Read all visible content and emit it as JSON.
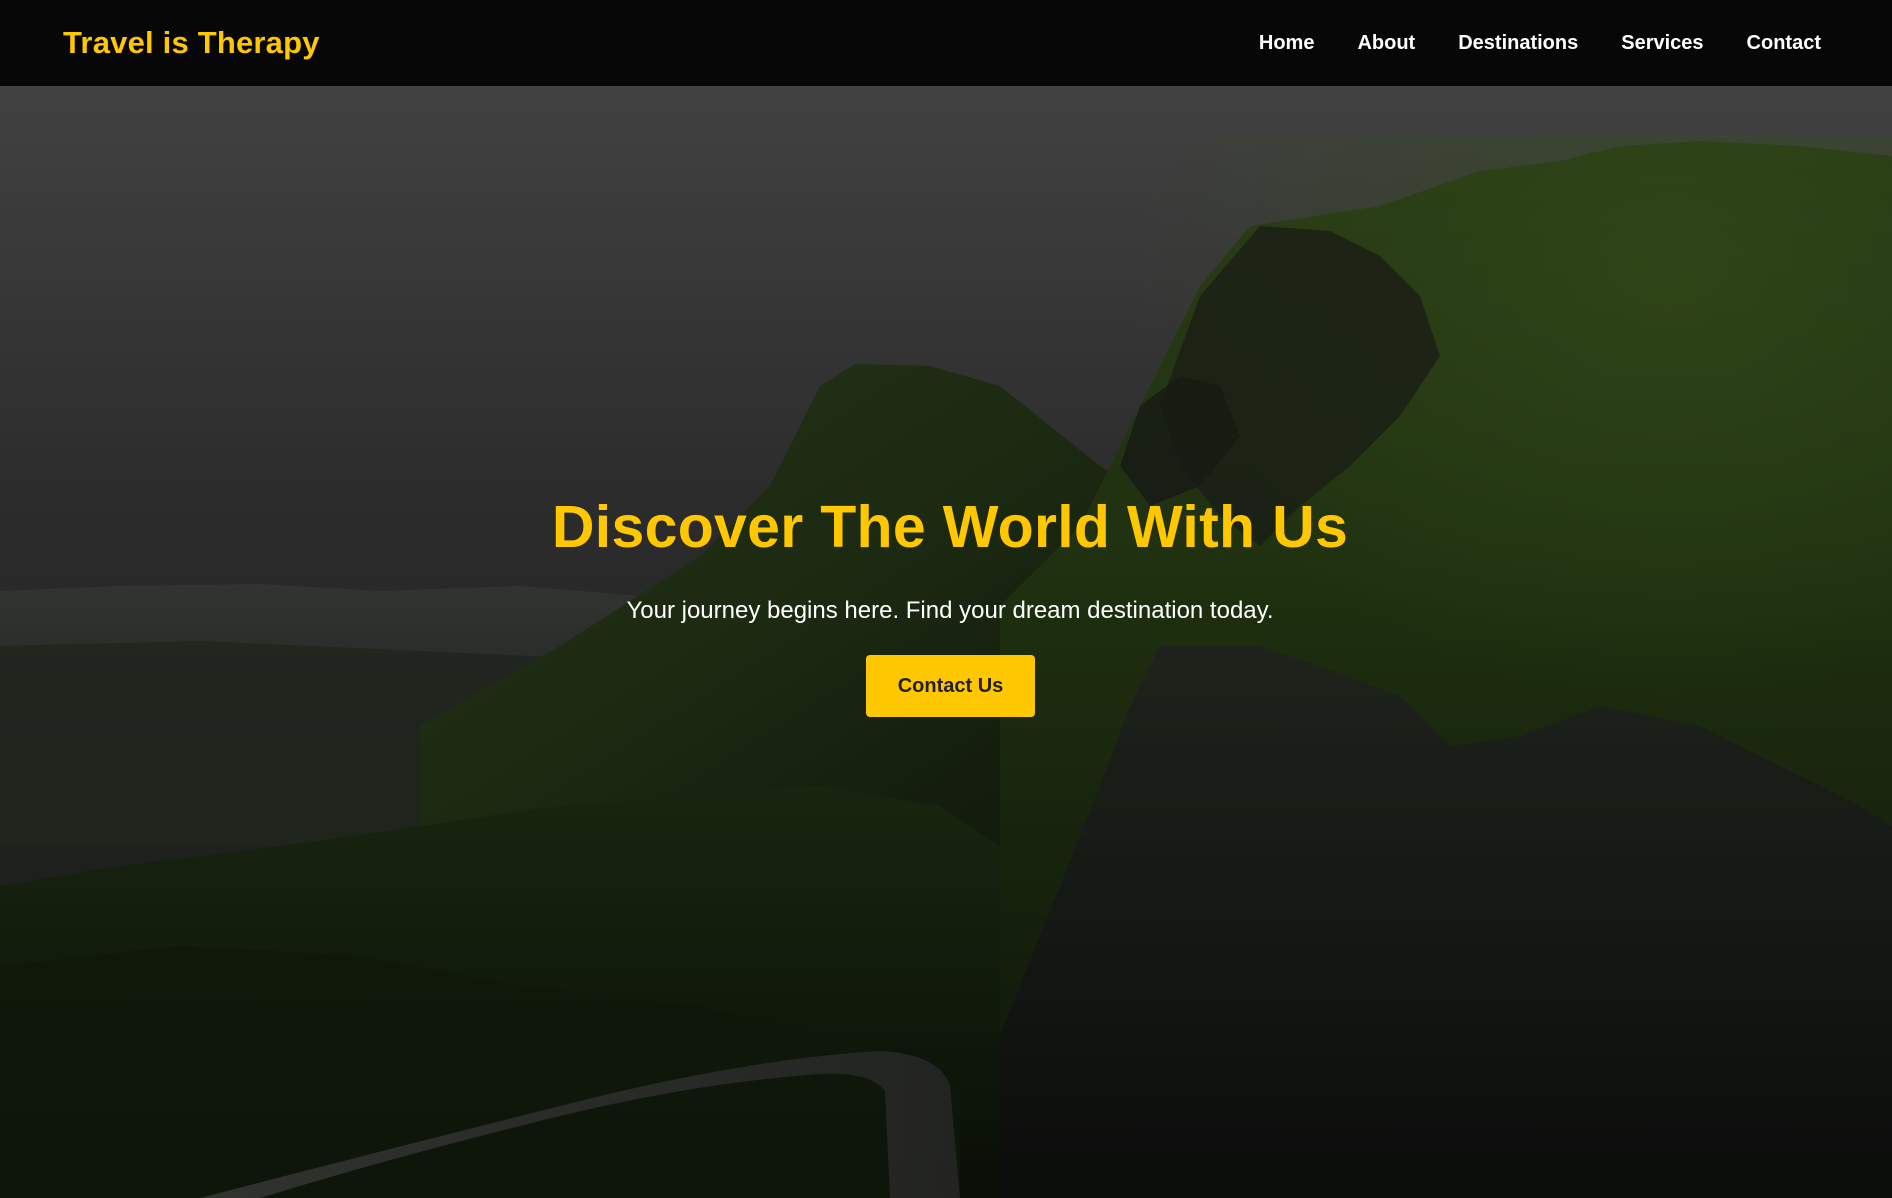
{
  "colors": {
    "accent": "#FFC700",
    "nav_background": "#070707",
    "nav_text": "#FFFFFF",
    "button_text": "#222222"
  },
  "header": {
    "brand": "Travel is Therapy",
    "nav": [
      {
        "label": "Home"
      },
      {
        "label": "About"
      },
      {
        "label": "Destinations"
      },
      {
        "label": "Services"
      },
      {
        "label": "Contact"
      }
    ]
  },
  "hero": {
    "title": "Discover The World With Us",
    "subtitle": "Your journey begins here. Find your dream destination today.",
    "button_label": "Contact Us"
  }
}
